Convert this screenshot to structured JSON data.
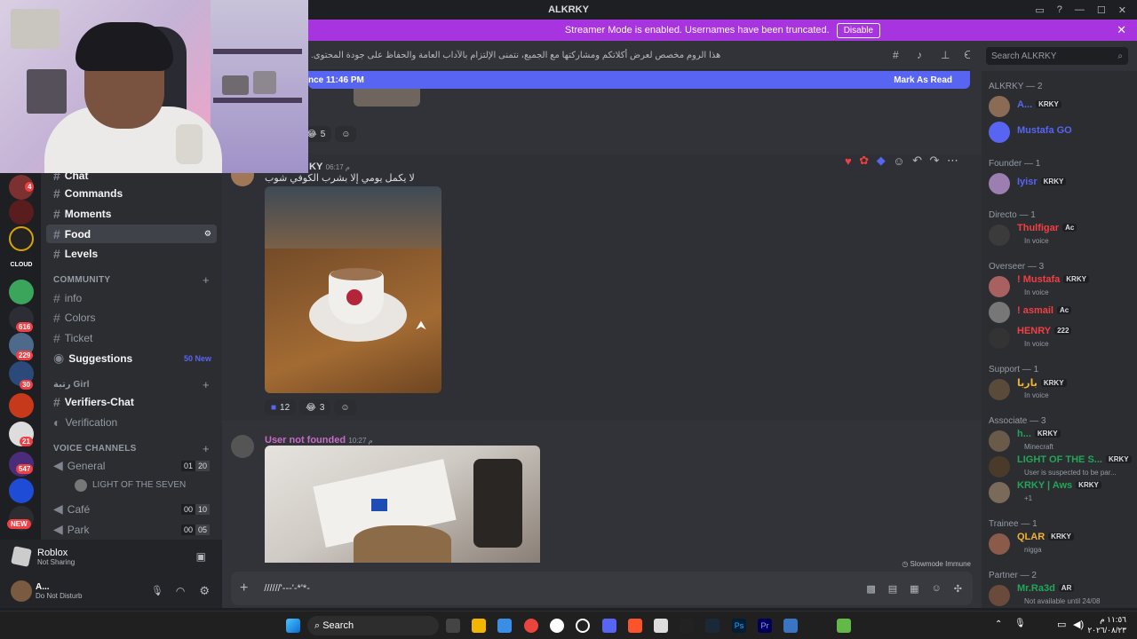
{
  "window": {
    "title": "ALKRKY"
  },
  "banner": {
    "text": "Streamer Mode is enabled. Usernames have been truncated.",
    "button": "Disable",
    "color": "#a834e0"
  },
  "header": {
    "topic": "هذا الروم مخصص لعرض أكلاتكم ومشاركتها مع الجميع، نتمنى الإلتزام بالآداب العامة والحفاظ على جودة المحتوى.",
    "search_placeholder": "Search ALKRKY"
  },
  "new_messages_bar": {
    "text": "nce 11:46 PM",
    "action": "Mark As Read",
    "color": "#5865f2"
  },
  "server_badges": [
    "4",
    "616",
    "229",
    "30",
    "21",
    "547"
  ],
  "server_new_label": "NEW",
  "channels": {
    "top": [
      {
        "name": "Chat"
      },
      {
        "name": "Commands"
      },
      {
        "name": "Moments"
      },
      {
        "name": "Food"
      },
      {
        "name": "Levels"
      }
    ],
    "community_category": "COMMUNITY",
    "community": [
      {
        "name": "info"
      },
      {
        "name": "Colors"
      },
      {
        "name": "Ticket"
      },
      {
        "name": "Suggestions",
        "badge": "50 New"
      }
    ],
    "girl_category": "رتبة Girl",
    "girl": [
      {
        "name": "Verifiers-Chat"
      },
      {
        "name": "Verification"
      }
    ],
    "voice_category": "VOICE CHANNELS",
    "voice": [
      {
        "name": "General",
        "current": "01",
        "limit": "20"
      },
      {
        "name": "Café",
        "current": "00",
        "limit": "10"
      },
      {
        "name": "Park",
        "current": "00",
        "limit": "05"
      }
    ],
    "voice_user": "LIGHT OF THE SEVEN"
  },
  "activity": {
    "title": "Roblox",
    "subtitle": "Not Sharing"
  },
  "user": {
    "name": "A...",
    "status": "Do Not Disturb"
  },
  "messages": [
    {
      "reaction_count": "5"
    },
    {
      "author": "KY",
      "time": "06:17 م",
      "text": "لا يكمل يومي إلا بشرب الكوفي شوب",
      "reactions": [
        {
          "count": "12"
        },
        {
          "count": "3"
        }
      ]
    },
    {
      "author": "User not founded",
      "time": "10:27 م"
    }
  ],
  "slowmode": "Slowmode Immune",
  "composer": {
    "value": "//////'---'-*'*-"
  },
  "members": {
    "groups": [
      {
        "title": "ALKRKY — 2",
        "members": [
          {
            "name": "A...",
            "tag": "KRKY",
            "color": "#5865f2"
          },
          {
            "name": "Mustafa GO",
            "color": "#5865f2"
          }
        ]
      },
      {
        "title": "Founder — 1",
        "members": [
          {
            "name": "Iyisr",
            "tag": "KRKY",
            "color": "#5865f2"
          }
        ]
      },
      {
        "title": "Directo — 1",
        "members": [
          {
            "name": "Thulfigar",
            "tag": "Ac",
            "status": "In voice",
            "color": "#f23f43"
          }
        ]
      },
      {
        "title": "Overseer — 3",
        "members": [
          {
            "name": "! Mustafa",
            "tag": "KRKY",
            "status": "In voice",
            "color": "#f23f43"
          },
          {
            "name": "! asmail",
            "tag": "Ac",
            "color": "#f23f43"
          },
          {
            "name": "HENRY",
            "tag": "222",
            "status": "In voice",
            "color": "#f23f43"
          }
        ]
      },
      {
        "title": "Support — 1",
        "members": [
          {
            "name": "باربا",
            "tag": "KRKY",
            "status": "In voice",
            "color": "#f0b232"
          }
        ]
      },
      {
        "title": "Associate — 3",
        "members": [
          {
            "name": "h...",
            "tag": "KRKY",
            "status": "Minecraft",
            "color": "#23a55a"
          },
          {
            "name": "LIGHT OF THE S...",
            "tag": "KRKY",
            "status": "User is suspected to be par...",
            "color": "#23a55a"
          },
          {
            "name": "KRKY | Aws",
            "tag": "KRKY",
            "status": "+1",
            "color": "#23a55a"
          }
        ]
      },
      {
        "title": "Trainee — 1",
        "members": [
          {
            "name": "QLAR",
            "tag": "KRKY",
            "status": "nigga",
            "color": "#f0b232"
          }
        ]
      },
      {
        "title": "Partner — 2",
        "members": [
          {
            "name": "Mr.Ra3d",
            "tag": "AR",
            "status": "Not available until 24/08",
            "color": "#23a55a"
          }
        ]
      }
    ]
  },
  "taskbar": {
    "search": "Search",
    "time": "١١:٥٦ م",
    "date": "٢٠٢٦/٠٨/٢٣"
  }
}
